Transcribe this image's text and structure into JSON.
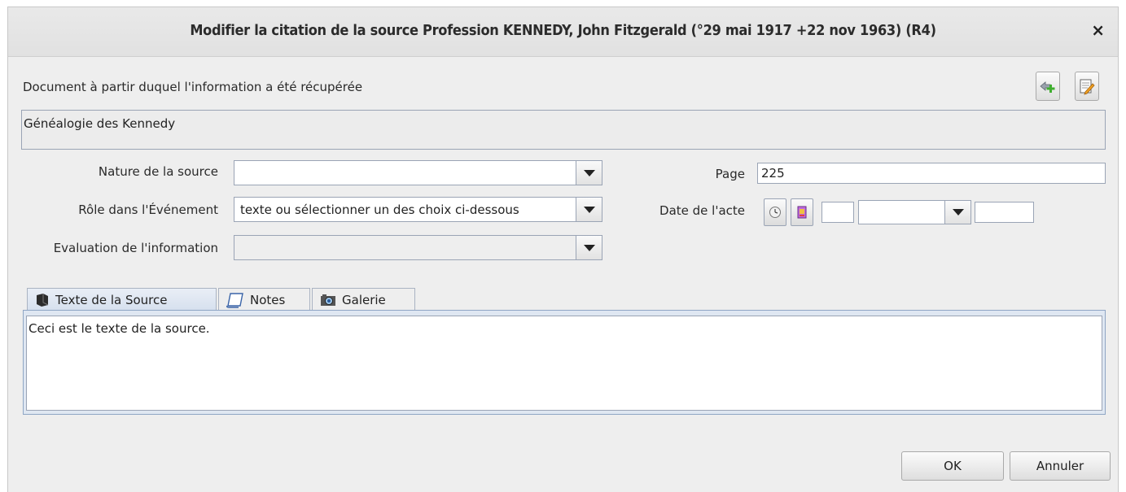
{
  "window": {
    "title": "Modifier la citation de la source Profession KENNEDY, John Fitzgerald (°29 mai 1917 +22 nov 1963) (R4)",
    "close": "×"
  },
  "source": {
    "label": "Document à partir duquel l'information a été récupérée",
    "value": "Généalogie des Kennedy"
  },
  "fields": {
    "nature_label": "Nature de la source",
    "nature_value": "",
    "role_label": "Rôle dans l'Événement",
    "role_value": "texte ou sélectionner un des choix ci-dessous",
    "evaluation_label": "Evaluation de l'information",
    "evaluation_value": "",
    "page_label": "Page",
    "page_value": "225",
    "date_label": "Date de l'acte",
    "date_day": "",
    "date_month": "",
    "date_year": ""
  },
  "tabs": [
    {
      "label": "Texte de la Source",
      "icon": "book-icon"
    },
    {
      "label": "Notes",
      "icon": "scroll-icon"
    },
    {
      "label": "Galerie",
      "icon": "camera-icon"
    }
  ],
  "source_text": "Ceci est le texte de la source.",
  "buttons": {
    "ok": "OK",
    "cancel": "Annuler"
  }
}
